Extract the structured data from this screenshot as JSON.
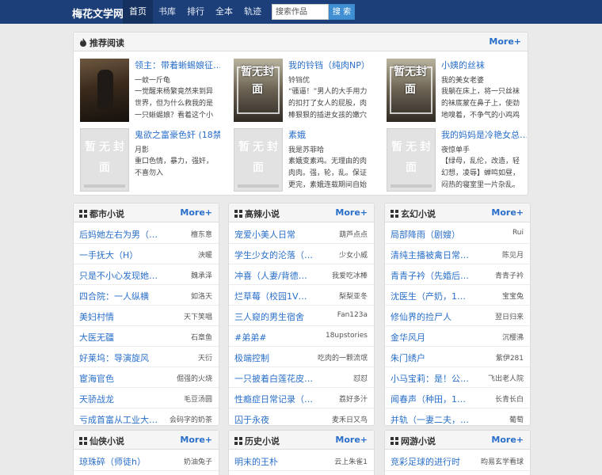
{
  "site": {
    "brand": "梅花文学网",
    "nav": [
      {
        "label": "首页",
        "active": true
      },
      {
        "label": "书库",
        "active": false
      },
      {
        "label": "排行",
        "active": false
      },
      {
        "label": "全本",
        "active": false
      },
      {
        "label": "轨迹",
        "active": false
      }
    ],
    "search": {
      "placeholder": "搜索作品",
      "button": "搜 索"
    }
  },
  "recommend": {
    "title": "推荐阅读",
    "icon": "fire-icon",
    "more": "More+",
    "placeholder_cover_text": "暂无封面",
    "books": [
      {
        "title": "领主：带着蜥蜴娘征…",
        "author": "一蚊一斤龟",
        "desc": "一觉醒来杨繁竟然来到异世界，但为什么救我的是一只蜥蜴娘？看着这个小小图书管",
        "cover": "art1"
      },
      {
        "title": "我的铃铛（纯肉NP）",
        "author": "铃铛优",
        "desc": "“骚逼！”男人的大手用力的扣打了女人的屁股，肉棒狠狠的插进女孩的嫩穴里。“啊……哥",
        "cover": "art2"
      },
      {
        "title": "小姨的丝袜",
        "author": "我的美女老婆",
        "desc": "我躺在床上，将一只丝袜的袜底蒙在鼻子上，使劲地嗅着，不争气的小鸡鸡",
        "cover": "art2"
      },
      {
        "title": "鬼欲之富豪色奸 (18禁…",
        "author": "月影",
        "desc": "重口色情，暴力，强奸，不喜勿入",
        "cover": "placeholder"
      },
      {
        "title": "素娥",
        "author": "我是苏菲哈",
        "desc": "素娥变素鸡。无理由的肉肉肉。强，轮，乱。保证更完，素娥连载期间自始至终免费",
        "cover": "placeholder"
      },
      {
        "title": "我的妈妈是冷艳女总…",
        "author": "夜惊单手",
        "desc": "【绿母，乱伦，改造，轻幻想，凌辱】蝉鸣如昼，闷热的寝室里一片杂乱。水龙头哗哗",
        "cover": "placeholder"
      }
    ]
  },
  "categories": [
    {
      "name": "都市小说",
      "more": "More+",
      "items": [
        {
          "title": "后妈她左右为男（…",
          "author": "檀东意"
        },
        {
          "title": "一手抚大（H）",
          "author": "泱暖"
        },
        {
          "title": "只是不小心发现她…",
          "author": "魏承泽"
        },
        {
          "title": "四合院：一人纵横",
          "author": "如洛天"
        },
        {
          "title": "美妇村情",
          "author": "天下笑唱"
        },
        {
          "title": "大医无疆",
          "author": "石章鱼"
        },
        {
          "title": "好莱坞：导演旋风",
          "author": "天衍"
        },
        {
          "title": "宦海官色",
          "author": "倔强的火烧"
        },
        {
          "title": "天骄战龙",
          "author": "毛豆汤圆"
        },
        {
          "title": "亏成首富从工业大…",
          "author": "会码字的奶茶"
        }
      ]
    },
    {
      "name": "高辣小说",
      "more": "More+",
      "items": [
        {
          "title": "宠爱小美人日常",
          "author": "葫芦点点"
        },
        {
          "title": "学生少女的沦落（…",
          "author": "少女小威"
        },
        {
          "title": "冲喜（人妻/背德…",
          "author": "我爱吃冰棒"
        },
        {
          "title": "烂草莓（校园1V…",
          "author": "梨梨亚冬"
        },
        {
          "title": "三人窥的男生宿舍",
          "author": "Fan123a"
        },
        {
          "title": "#弟弟#",
          "author": "18upstories"
        },
        {
          "title": "极端控制",
          "author": "吃肉的一颗流氓"
        },
        {
          "title": "一只披着白莲花皮…",
          "author": "怼怼"
        },
        {
          "title": "性瘾症日常记录（…",
          "author": "荔好多汁"
        },
        {
          "title": "囚于永夜",
          "author": "麦禾日又鸟"
        }
      ]
    },
    {
      "name": "玄幻小说",
      "more": "More+",
      "items": [
        {
          "title": "局部降雨（剧嫂）",
          "author": "Rui"
        },
        {
          "title": "清纯主播被禽日常…",
          "author": "陈见月"
        },
        {
          "title": "青青子衿（先婚后…",
          "author": "青青子衿"
        },
        {
          "title": "沈医生（产奶，1…",
          "author": "宝宝兔"
        },
        {
          "title": "修仙界的捡尸人",
          "author": "翌日归来"
        },
        {
          "title": "金华风月",
          "author": "沉樱沸"
        },
        {
          "title": "朱门绣户",
          "author": "紫伊281"
        },
        {
          "title": "小马宝莉：是！公…",
          "author": "飞出老人院"
        },
        {
          "title": "闻春声（种田，1…",
          "author": "长青长白"
        },
        {
          "title": "并轨（一妻二夫，…",
          "author": "葡萄"
        }
      ]
    },
    {
      "name": "仙侠小说",
      "more": "More+",
      "items": [
        {
          "title": "琼珠碎（师徒h）",
          "author": "奶油兔子"
        }
      ]
    },
    {
      "name": "历史小说",
      "more": "More+",
      "items": [
        {
          "title": "明末的王朴",
          "author": "云上朱雀1"
        }
      ]
    },
    {
      "name": "网游小说",
      "more": "More+",
      "items": [
        {
          "title": "竞彩足球的进行时",
          "author": "昀易玄学看球"
        }
      ]
    }
  ],
  "colors": {
    "nav_bg": "#1c3f7a",
    "link": "#2a6fc9",
    "search_btn": "#3f8fd2"
  }
}
